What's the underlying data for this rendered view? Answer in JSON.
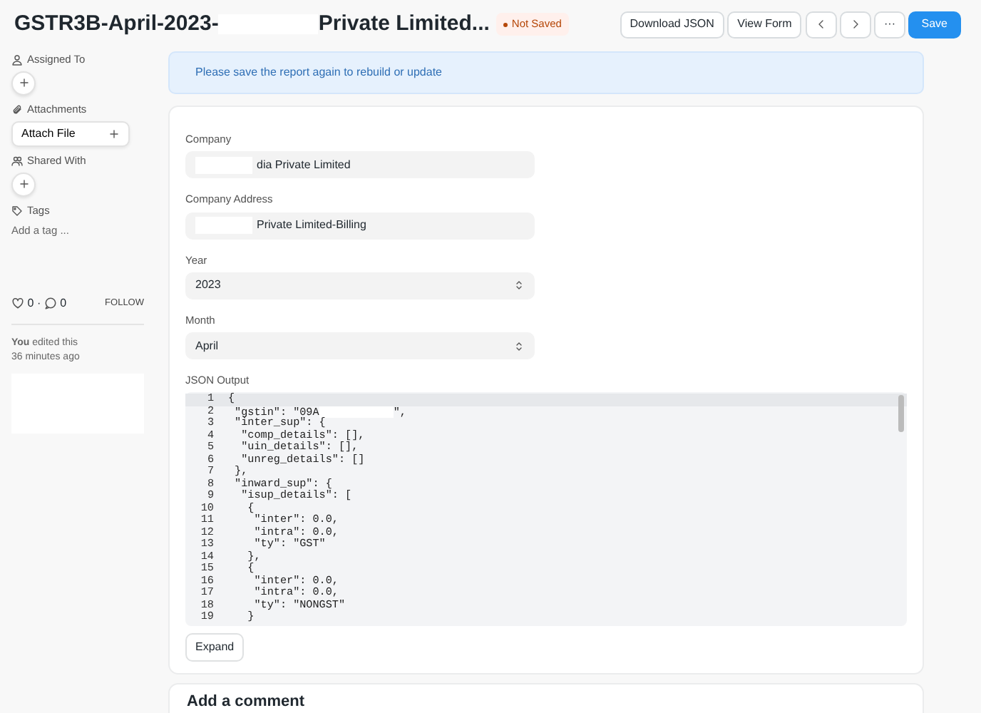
{
  "header": {
    "title_start": "GSTR3B-April-2023-",
    "title_end": "Private Limited...",
    "status": "Not Saved",
    "buttons": [
      {
        "kind": "text",
        "label": "Download JSON"
      },
      {
        "kind": "text",
        "label": "View Form"
      },
      {
        "kind": "prev"
      },
      {
        "kind": "next"
      },
      {
        "kind": "text",
        "label": "···"
      },
      {
        "kind": "primary",
        "label": "Save"
      }
    ]
  },
  "sidebar": {
    "sections": [
      {
        "label": "Assigned To",
        "kind": "add"
      },
      {
        "label": "Attachments",
        "kind": "attach",
        "button": "Attach File"
      },
      {
        "label": "Shared With",
        "kind": "add"
      },
      {
        "label": "Tags",
        "kind": "tags",
        "placeholder": "Add a tag ..."
      }
    ],
    "likes": "0",
    "separator": "·",
    "comments": "0",
    "follow": "FOLLOW",
    "activity": "**You** edited this",
    "activity_time": "36 minutes ago"
  },
  "banner": "Please save the report again to rebuild or update",
  "form": {
    "fields": [
      {
        "label": "Company",
        "kind": "data",
        "value": "dia Private Limited",
        "redacted": true
      },
      {
        "label": "Company Address",
        "kind": "data",
        "value": "Private Limited-Billing",
        "redacted": true
      },
      {
        "label": "Year",
        "kind": "select",
        "value": "2023",
        "redacted": false
      },
      {
        "label": "Month",
        "kind": "select",
        "value": "April",
        "redacted": false
      }
    ],
    "code_label": "JSON Output",
    "code_lines": [
      {
        "no": "1",
        "text": "{",
        "active": true
      },
      {
        "no": "2",
        "text": " \"gstin\": \"09A",
        "tail": "\",",
        "redacted": true,
        "active": false
      },
      {
        "no": "3",
        "text": " \"inter_sup\": {",
        "active": false
      },
      {
        "no": "4",
        "text": "  \"comp_details\": [],",
        "active": false
      },
      {
        "no": "5",
        "text": "  \"uin_details\": [],",
        "active": false
      },
      {
        "no": "6",
        "text": "  \"unreg_details\": []",
        "active": false
      },
      {
        "no": "7",
        "text": " },",
        "active": false
      },
      {
        "no": "8",
        "text": " \"inward_sup\": {",
        "active": false
      },
      {
        "no": "9",
        "text": "  \"isup_details\": [",
        "active": false
      },
      {
        "no": "10",
        "text": "   {",
        "active": false
      },
      {
        "no": "11",
        "text": "    \"inter\": 0.0,",
        "active": false
      },
      {
        "no": "12",
        "text": "    \"intra\": 0.0,",
        "active": false
      },
      {
        "no": "13",
        "text": "    \"ty\": \"GST\"",
        "active": false
      },
      {
        "no": "14",
        "text": "   },",
        "active": false
      },
      {
        "no": "15",
        "text": "   {",
        "active": false
      },
      {
        "no": "16",
        "text": "    \"inter\": 0.0,",
        "active": false
      },
      {
        "no": "17",
        "text": "    \"intra\": 0.0,",
        "active": false
      },
      {
        "no": "18",
        "text": "    \"ty\": \"NONGST\"",
        "active": false
      },
      {
        "no": "19",
        "text": "   }",
        "active": false
      }
    ],
    "expand": "Expand"
  },
  "comment_heading": "Add a comment"
}
